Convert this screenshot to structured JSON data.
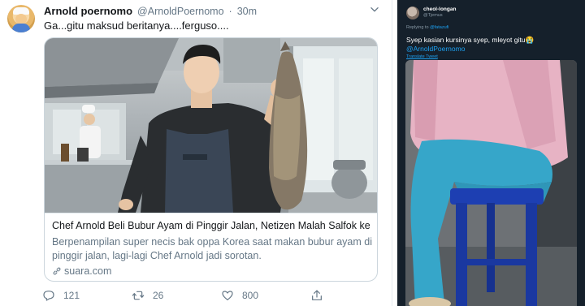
{
  "tweet": {
    "display_name": "Arnold poernomo",
    "handle": "@ArnoldPoernomo",
    "separator": "·",
    "time": "30m",
    "text": "Ga...gitu maksud beritanya....ferguso....",
    "card": {
      "title": "Chef Arnold Beli Bubur Ayam di Pinggir Jalan, Netizen Malah Salfok ke ...",
      "description": "Berpenampilan super necis bak oppa Korea saat makan bubur ayam di pinggir jalan, lagi-lagi Chef Arnold jadi sorotan.",
      "domain": "suara.com"
    },
    "actions": {
      "replies": "121",
      "retweets": "26",
      "likes": "800"
    }
  },
  "embedded_reply": {
    "display_name": "cheol-longan",
    "handle": "@Tjemus",
    "replying_prefix": "Replying to",
    "replying_to": "@fatazufi",
    "text": "Syep kasian kursinya syep, mleyot gitu😭",
    "mention": "@ArnoldPoernomo",
    "translate_label": "Translate Tweet"
  },
  "colors": {
    "text_primary": "#14171a",
    "text_secondary": "#657786",
    "link_blue": "#1da1f2",
    "dark_bg": "#15202b"
  },
  "icons": {
    "reply": "reply-icon",
    "retweet": "retweet-icon",
    "like": "heart-icon",
    "share": "share-icon",
    "caret": "chevron-down-icon",
    "link": "link-icon"
  }
}
